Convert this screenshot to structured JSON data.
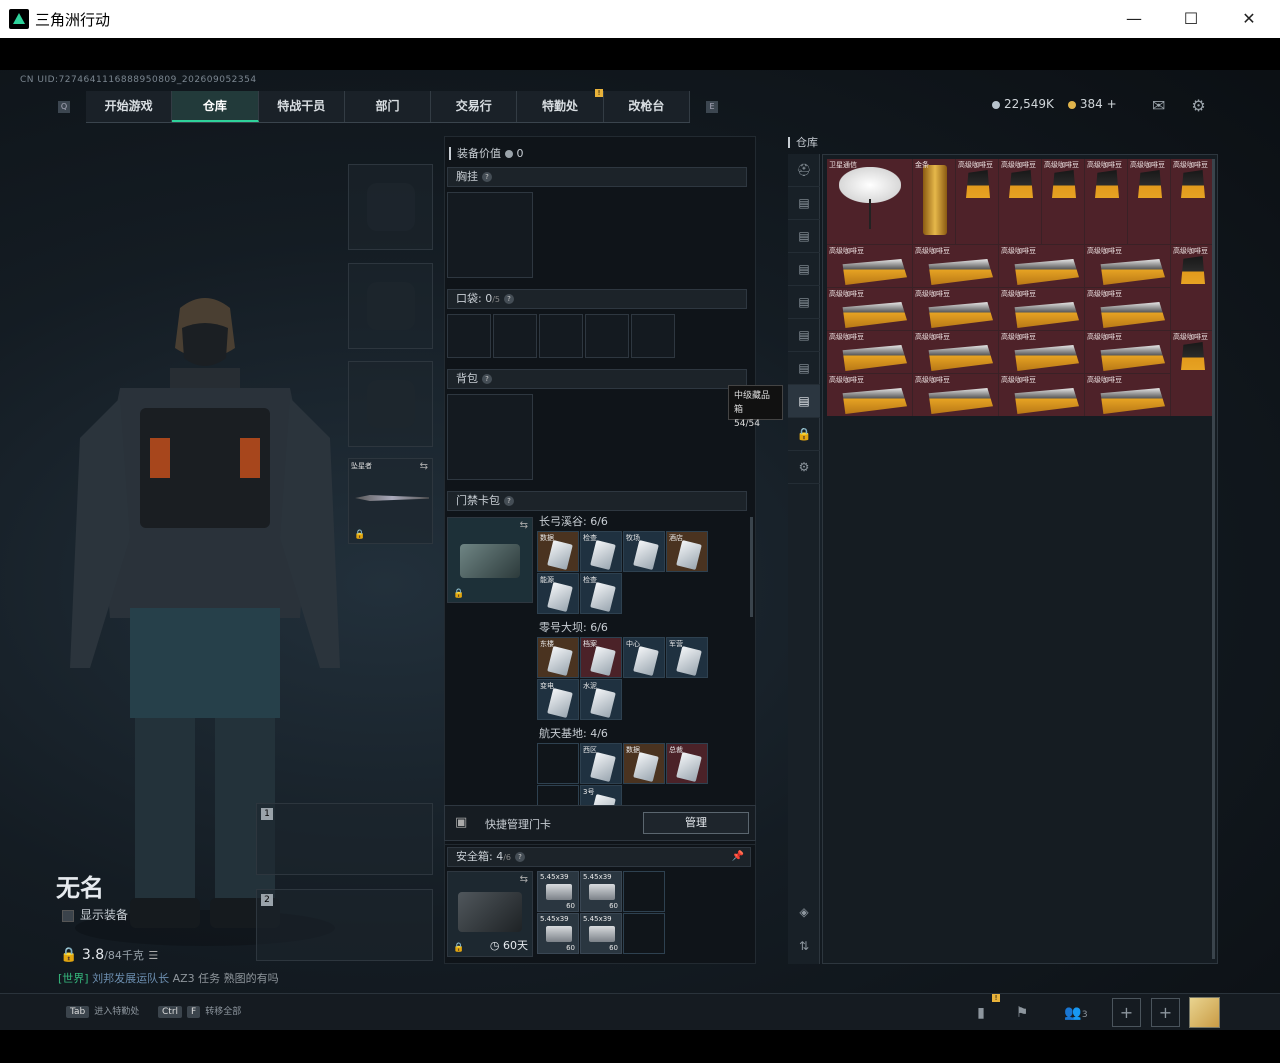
{
  "window": {
    "title": "三角洲行动",
    "minimize": "—",
    "maximize": "☐",
    "close": "✕"
  },
  "uid": "CN UID:7274641116888950809_202609052354",
  "nav": {
    "key_left": "Q",
    "key_right": "E",
    "badge": "!",
    "tabs": [
      "开始游戏",
      "仓库",
      "特战干员",
      "部门",
      "交易行",
      "特勤处",
      "改枪台"
    ],
    "active": "仓库"
  },
  "currency": {
    "silver": "22,549K",
    "gold": "384 +",
    "silver_color": "#b7c3cc",
    "gold_color": "#e0b44b"
  },
  "icons": {
    "mail": "mail-icon",
    "settings": "gear-icon"
  },
  "character": {
    "name": "无名",
    "show_equipment": "显示装备",
    "weight": "3.8",
    "weight_max": "/84千克"
  },
  "chat": {
    "channel": "[世界]",
    "user": "刘邦发展运队长",
    "message": "AZ3 任务 熟图的有吗"
  },
  "equip": {
    "melee_name": "坠星者"
  },
  "mid": {
    "gear_value_label": "装备价值",
    "gear_value": "0",
    "chest": "胸挂",
    "pockets": "口袋:",
    "pockets_count": "0",
    "pockets_max": "/5",
    "backpack": "背包",
    "keycard": "门禁卡包",
    "groups": [
      {
        "title": "长弓溪谷: 6/6",
        "cards": [
          {
            "n": "数据",
            "c": "gold"
          },
          {
            "n": "检查",
            "c": ""
          },
          {
            "n": "牧场",
            "c": ""
          },
          {
            "n": "酒店",
            "c": "gold"
          },
          {
            "n": "能源",
            "c": ""
          },
          {
            "n": "检查",
            "c": ""
          }
        ]
      },
      {
        "title": "零号大坝: 6/6",
        "cards": [
          {
            "n": "东楼",
            "c": "gold"
          },
          {
            "n": "档案",
            "c": "red"
          },
          {
            "n": "中心",
            "c": ""
          },
          {
            "n": "军营",
            "c": ""
          },
          {
            "n": "变电",
            "c": ""
          },
          {
            "n": "水泥",
            "c": ""
          }
        ]
      },
      {
        "title": "航天基地: 4/6",
        "cards": [
          {
            "n": "",
            "c": "empty"
          },
          {
            "n": "西区",
            "c": ""
          },
          {
            "n": "数据",
            "c": "gold"
          },
          {
            "n": "总裁",
            "c": "red"
          },
          {
            "n": "",
            "c": "empty"
          },
          {
            "n": "3号",
            "c": ""
          }
        ]
      }
    ],
    "quick_manage": "快捷管理门卡",
    "manage_btn": "管理",
    "safe_label": "安全箱:",
    "safe_count": "4",
    "safe_max": "/6",
    "safe_timer": "60天",
    "ammo": [
      {
        "n": "5.45x39",
        "c": "60"
      },
      {
        "n": "5.45x39",
        "c": "60"
      },
      {
        "n": "5.45x39",
        "c": "60"
      },
      {
        "n": "5.45x39",
        "c": "60"
      }
    ]
  },
  "tooltip": {
    "line1": "中级藏品箱",
    "line2": "54/54"
  },
  "stash": {
    "label": "仓库",
    "sidebar": [
      "helmet-icon",
      "case-icon",
      "case-icon",
      "case-icon",
      "case-icon",
      "case-icon",
      "case-icon",
      "case-icon",
      "lock-icon",
      "gear-icon"
    ],
    "items": [
      {
        "name": "卫星通信",
        "kind": "dish",
        "col": 1,
        "row": 1,
        "w": 2,
        "h": 2
      },
      {
        "name": "金条",
        "kind": "gb",
        "col": 3,
        "row": 1,
        "w": 1,
        "h": 2
      },
      {
        "name": "高级咖啡豆",
        "kind": "bag",
        "col": 4,
        "row": 1,
        "w": 1,
        "h": 2
      },
      {
        "name": "高级咖啡豆",
        "kind": "bag",
        "col": 5,
        "row": 1,
        "w": 1,
        "h": 2
      },
      {
        "name": "高级咖啡豆",
        "kind": "bag",
        "col": 6,
        "row": 1,
        "w": 1,
        "h": 2
      },
      {
        "name": "高级咖啡豆",
        "kind": "bag",
        "col": 7,
        "row": 1,
        "w": 1,
        "h": 2
      },
      {
        "name": "高级咖啡豆",
        "kind": "bag",
        "col": 8,
        "row": 1,
        "w": 1,
        "h": 2
      },
      {
        "name": "高级咖啡豆",
        "kind": "bag",
        "col": 9,
        "row": 1,
        "w": 1,
        "h": 2
      },
      {
        "name": "高级咖啡豆",
        "kind": "brick",
        "col": 1,
        "row": 3,
        "w": 2,
        "h": 1
      },
      {
        "name": "高级咖啡豆",
        "kind": "brick",
        "col": 3,
        "row": 3,
        "w": 2,
        "h": 1
      },
      {
        "name": "高级咖啡豆",
        "kind": "brick",
        "col": 5,
        "row": 3,
        "w": 2,
        "h": 1
      },
      {
        "name": "高级咖啡豆",
        "kind": "brick",
        "col": 7,
        "row": 3,
        "w": 2,
        "h": 1
      },
      {
        "name": "高级咖啡豆",
        "kind": "bag",
        "col": 9,
        "row": 3,
        "w": 1,
        "h": 2
      },
      {
        "name": "高级咖啡豆",
        "kind": "brick",
        "col": 1,
        "row": 4,
        "w": 2,
        "h": 1
      },
      {
        "name": "高级咖啡豆",
        "kind": "brick",
        "col": 3,
        "row": 4,
        "w": 2,
        "h": 1
      },
      {
        "name": "高级咖啡豆",
        "kind": "brick",
        "col": 5,
        "row": 4,
        "w": 2,
        "h": 1
      },
      {
        "name": "高级咖啡豆",
        "kind": "brick",
        "col": 7,
        "row": 4,
        "w": 2,
        "h": 1
      },
      {
        "name": "高级咖啡豆",
        "kind": "brick",
        "col": 1,
        "row": 5,
        "w": 2,
        "h": 1
      },
      {
        "name": "高级咖啡豆",
        "kind": "brick",
        "col": 3,
        "row": 5,
        "w": 2,
        "h": 1
      },
      {
        "name": "高级咖啡豆",
        "kind": "brick",
        "col": 5,
        "row": 5,
        "w": 2,
        "h": 1
      },
      {
        "name": "高级咖啡豆",
        "kind": "brick",
        "col": 7,
        "row": 5,
        "w": 2,
        "h": 1
      },
      {
        "name": "高级咖啡豆",
        "kind": "bag",
        "col": 9,
        "row": 5,
        "w": 1,
        "h": 2
      },
      {
        "name": "高级咖啡豆",
        "kind": "brick",
        "col": 1,
        "row": 6,
        "w": 2,
        "h": 1
      },
      {
        "name": "高级咖啡豆",
        "kind": "brick",
        "col": 3,
        "row": 6,
        "w": 2,
        "h": 1
      },
      {
        "name": "高级咖啡豆",
        "kind": "brick",
        "col": 5,
        "row": 6,
        "w": 2,
        "h": 1
      },
      {
        "name": "高级咖啡豆",
        "kind": "brick",
        "col": 7,
        "row": 6,
        "w": 2,
        "h": 1
      }
    ]
  },
  "bottom": {
    "tab_key": "Tab",
    "tab_label": "进入特勤处",
    "ctrl_key": "Ctrl",
    "f_key": "F",
    "transfer_label": "转移全部",
    "friends": "3",
    "badge": "!"
  }
}
